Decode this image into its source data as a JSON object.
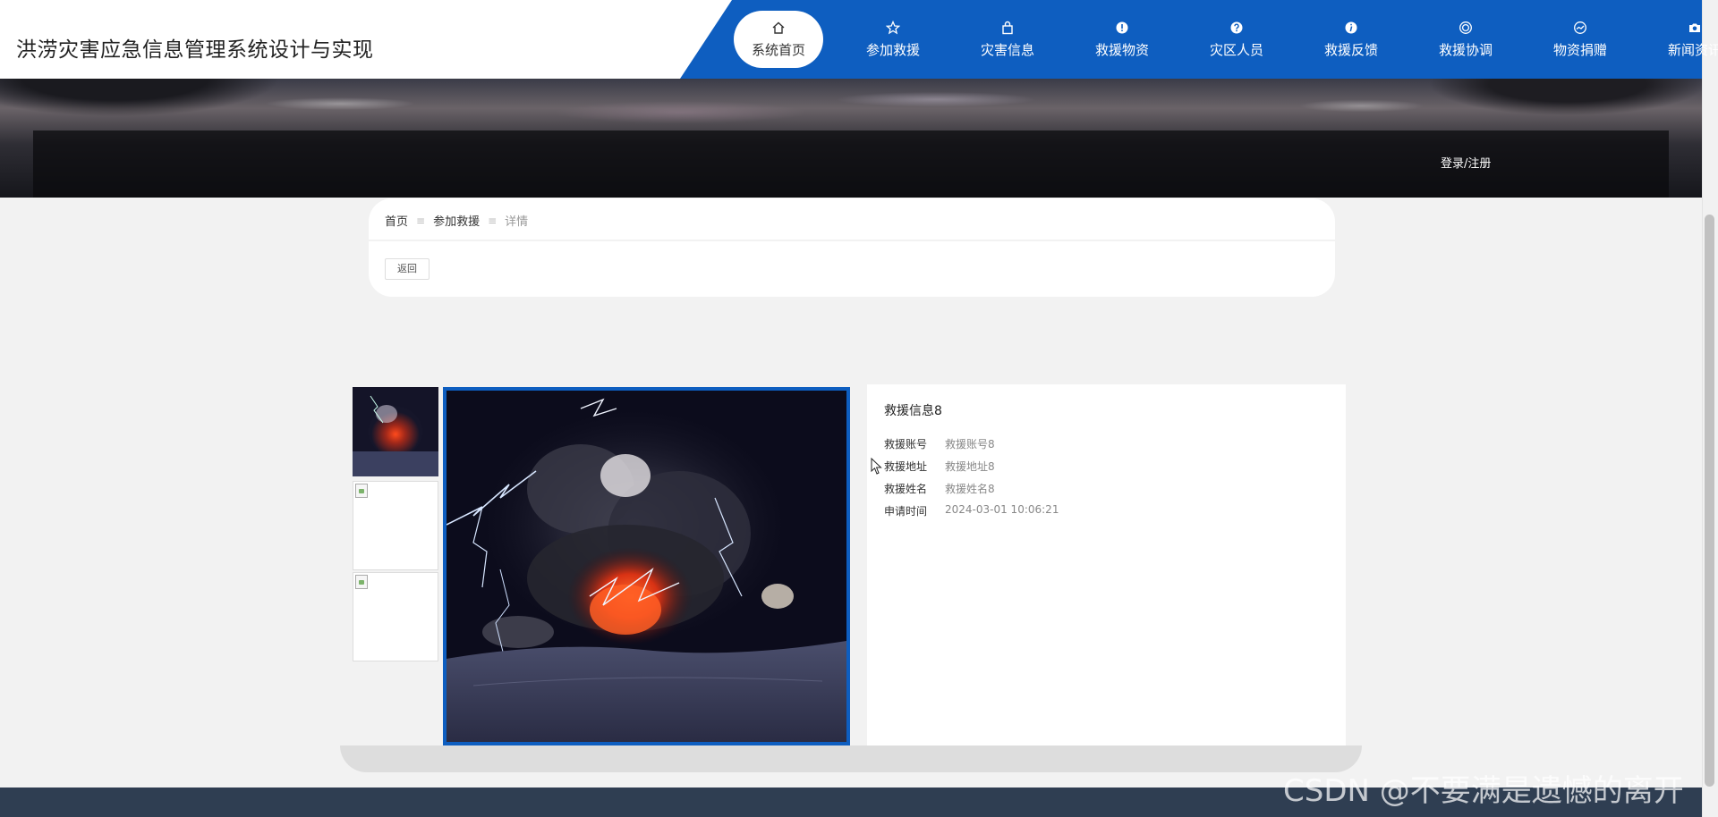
{
  "app": {
    "title": "洪涝灾害应急信息管理系统设计与实现"
  },
  "nav": {
    "items": [
      {
        "label": "系统首页",
        "icon": "home-icon",
        "active": true
      },
      {
        "label": "参加救援",
        "icon": "star-icon",
        "active": false
      },
      {
        "label": "灾害信息",
        "icon": "bag-icon",
        "active": false
      },
      {
        "label": "救援物资",
        "icon": "alert-circle-icon",
        "active": false
      },
      {
        "label": "灾区人员",
        "icon": "question-circle-icon",
        "active": false
      },
      {
        "label": "救援反馈",
        "icon": "info-circle-icon",
        "active": false
      },
      {
        "label": "救援协调",
        "icon": "target-icon",
        "active": false
      },
      {
        "label": "物资捐赠",
        "icon": "gauge-icon",
        "active": false
      },
      {
        "label": "新闻资讯",
        "icon": "camera-icon",
        "active": false
      }
    ]
  },
  "banner": {
    "login_label": "登录/注册"
  },
  "breadcrumb": {
    "home": "首页",
    "section": "参加救援",
    "current": "详情",
    "separator": "≡"
  },
  "actions": {
    "back_label": "返回"
  },
  "gallery": {
    "thumbnail_count": 3,
    "selected_index": 0
  },
  "detail": {
    "title": "救援信息8",
    "fields": [
      {
        "key": "救援账号",
        "value": "救援账号8"
      },
      {
        "key": "救援地址",
        "value": "救援地址8"
      },
      {
        "key": "救援姓名",
        "value": "救援姓名8"
      },
      {
        "key": "申请时间",
        "value": "2024-03-01 10:06:21"
      }
    ]
  },
  "watermark": {
    "text": "CSDN @不要满是遗憾的离开"
  },
  "colors": {
    "primary": "#0e5ec0",
    "footer": "#2f3e52",
    "page_bg": "#f2f2f2"
  }
}
